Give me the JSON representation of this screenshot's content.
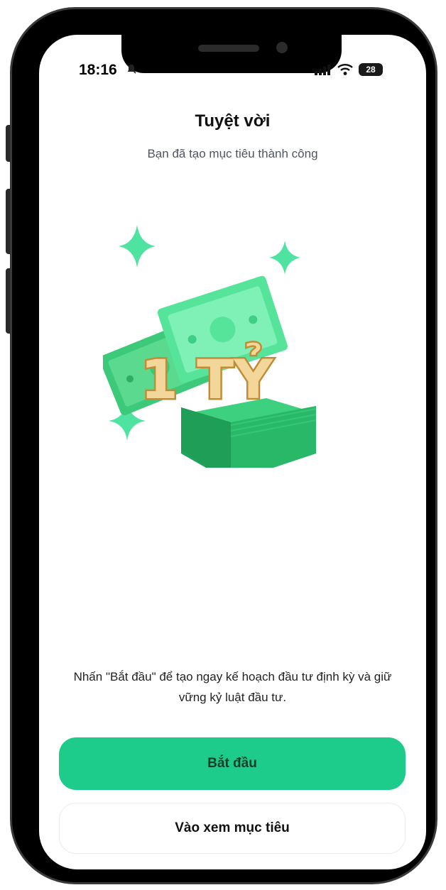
{
  "status_bar": {
    "time": "18:16",
    "battery": "28"
  },
  "header": {
    "title": "Tuyệt vời",
    "subtitle": "Bạn đã tạo mục tiêu thành công"
  },
  "illustration": {
    "label": "1 TỶ"
  },
  "content": {
    "description": "Nhấn \"Bắt đầu\" để tạo ngay kế hoạch đầu tư định kỳ và giữ vững kỷ luật đầu tư."
  },
  "actions": {
    "start_label": "Bắt đầu",
    "view_goal_label": "Vào xem mục tiêu"
  },
  "colors": {
    "primary": "#1dcc8a",
    "money_green": "#2fbf6c",
    "gold_text": "#d9a74a"
  },
  "icons": [
    "bell-slash-icon",
    "signal-icon",
    "wifi-icon",
    "battery-icon",
    "sparkle-icon"
  ]
}
